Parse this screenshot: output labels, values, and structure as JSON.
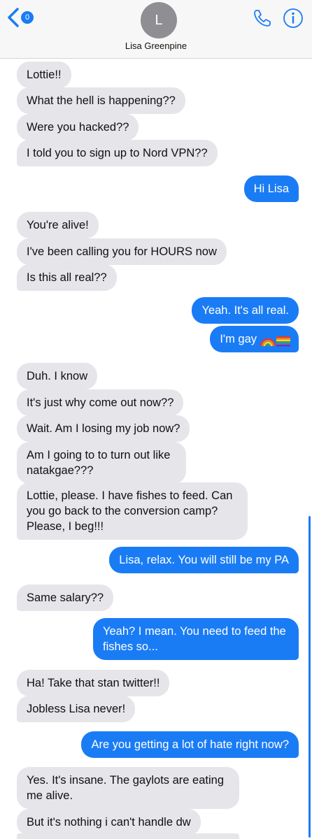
{
  "header": {
    "back_count": "0",
    "avatar_initial": "L",
    "contact_name": "Lisa Greenpine"
  },
  "messages": [
    {
      "from": "them",
      "text": "Lottie!!"
    },
    {
      "from": "them",
      "text": "What the hell is happening??"
    },
    {
      "from": "them",
      "text": "Were you hacked??"
    },
    {
      "from": "them",
      "text": "I told you to sign up to Nord VPN??"
    },
    {
      "from": "me",
      "text": "Hi Lisa"
    },
    {
      "from": "them",
      "text": "You're alive!"
    },
    {
      "from": "them",
      "text": "I've been calling you for HOURS now"
    },
    {
      "from": "them",
      "text": "Is this all real??"
    },
    {
      "from": "me",
      "text": "Yeah. It's all real."
    },
    {
      "from": "me",
      "text": "I'm gay"
    },
    {
      "from": "them",
      "text": "Duh. I know"
    },
    {
      "from": "them",
      "text": "It's just why come out now??"
    },
    {
      "from": "them",
      "text": "Wait. Am I losing my job now?"
    },
    {
      "from": "them",
      "text": "Am I going to to turn out like natakgae???"
    },
    {
      "from": "them",
      "text": "Lottie, please. I have fishes to feed. Can you go back to the conversion camp? Please, I beg!!!"
    },
    {
      "from": "me",
      "text": "Lisa, relax. You will still be my PA"
    },
    {
      "from": "them",
      "text": "Same salary??"
    },
    {
      "from": "me",
      "text": "Yeah? I mean. You need to feed the fishes so..."
    },
    {
      "from": "them",
      "text": "Ha! Take that stan twitter!!"
    },
    {
      "from": "them",
      "text": "Jobless Lisa never!"
    },
    {
      "from": "me",
      "text": "Are you getting a lot of hate right now?"
    },
    {
      "from": "them",
      "text": "Yes. It's insane. The gaylots are eating me alive."
    },
    {
      "from": "them",
      "text": "But it's nothing i can't handle dw"
    }
  ],
  "emoji": [
    "rainbow-emoji",
    "rainbow-flag-emoji"
  ],
  "colors": {
    "sent": "#1a7cf5",
    "received": "#e5e5ea",
    "accent": "#1a7cf5"
  }
}
